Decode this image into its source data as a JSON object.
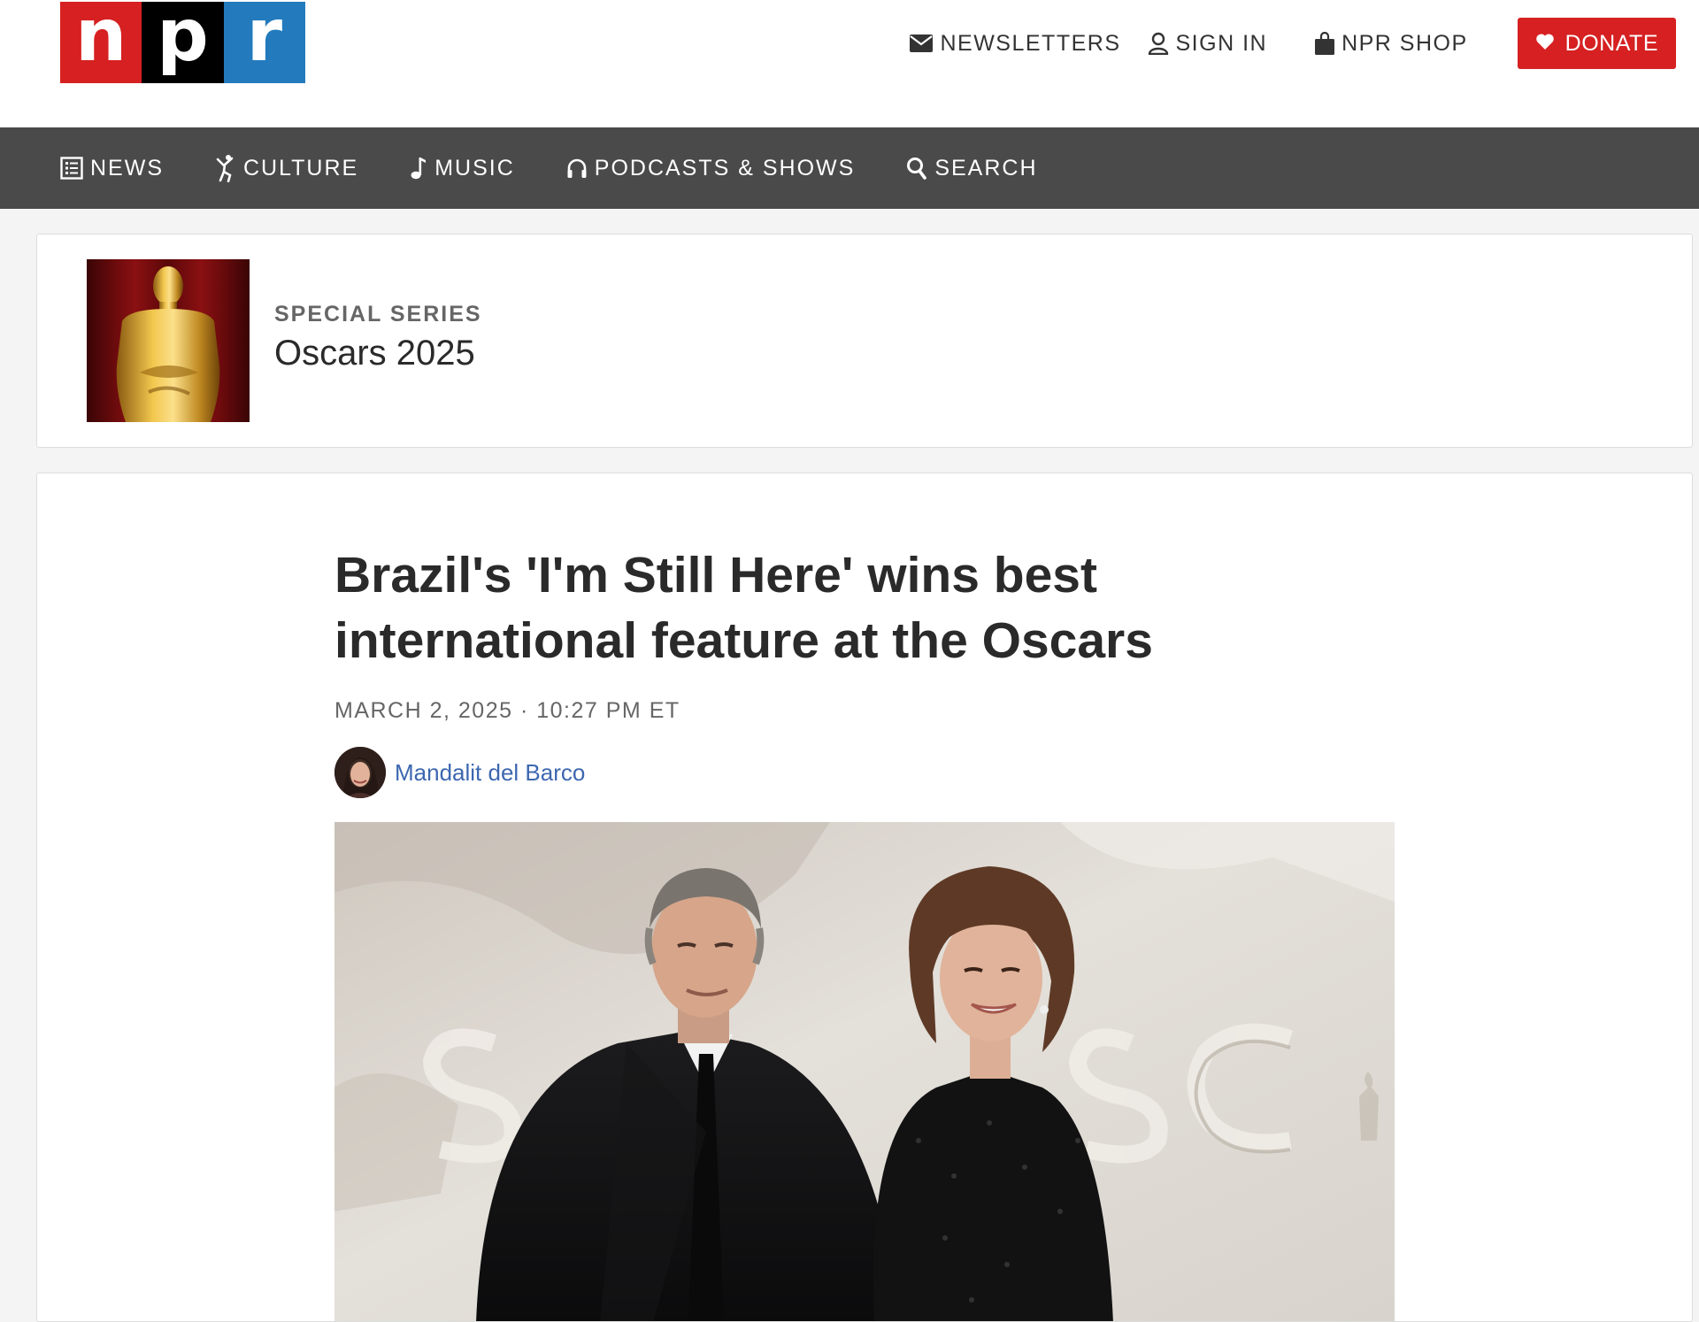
{
  "logo": {
    "letters": [
      "n",
      "p",
      "r"
    ],
    "colors": [
      "#d62021",
      "#000000",
      "#237bbd"
    ]
  },
  "utility_nav": {
    "newsletters": {
      "label": "NEWSLETTERS",
      "icon": "envelope-icon"
    },
    "sign_in": {
      "label": "SIGN IN",
      "icon": "user-icon"
    },
    "shop": {
      "label": "NPR SHOP",
      "icon": "shopping-bag-icon"
    },
    "donate": {
      "label": "DONATE",
      "icon": "heart-icon",
      "color": "#d62021"
    }
  },
  "main_nav": {
    "items": [
      {
        "label": "NEWS",
        "icon": "newspaper-icon"
      },
      {
        "label": "CULTURE",
        "icon": "dancer-icon"
      },
      {
        "label": "MUSIC",
        "icon": "music-note-icon"
      },
      {
        "label": "PODCASTS & SHOWS",
        "icon": "headphones-icon"
      },
      {
        "label": "SEARCH",
        "icon": "search-icon"
      }
    ],
    "background": "#4a4a4a"
  },
  "series": {
    "eyebrow": "SPECIAL SERIES",
    "title": "Oscars 2025",
    "thumbnail": "oscar-statuette-image"
  },
  "article": {
    "headline": "Brazil's 'I'm Still Here' wins best international feature at the Oscars",
    "dateline": "MARCH 2, 2025 · 10:27 PM ET",
    "author": "Mandalit del Barco",
    "author_link_color": "#3d67b0",
    "lead_image": "red-carpet-photo"
  }
}
